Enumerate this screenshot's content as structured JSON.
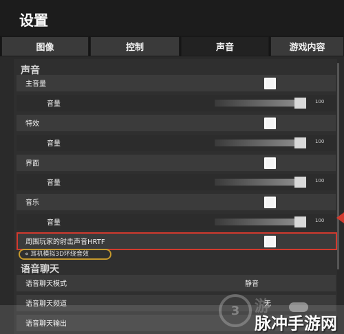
{
  "header": {
    "title": "设置"
  },
  "tabs": [
    {
      "label": "图像"
    },
    {
      "label": "控制"
    },
    {
      "label": "声音"
    },
    {
      "label": "游戏内容"
    }
  ],
  "sound": {
    "section_title": "声音",
    "items": [
      {
        "label": "主音量",
        "checked": false,
        "volume_label": "音量",
        "volume_value": "100",
        "level": 1.0
      },
      {
        "label": "特效",
        "checked": false,
        "volume_label": "音量",
        "volume_value": "100",
        "level": 1.0
      },
      {
        "label": "界面",
        "checked": false,
        "volume_label": "音量",
        "volume_value": "100",
        "level": 1.0
      },
      {
        "label": "音乐",
        "checked": false,
        "volume_label": "音量",
        "volume_value": "100",
        "level": 1.0
      }
    ],
    "hrtf": {
      "label": "周围玩家的射击声音HRTF",
      "checked": false,
      "note": "耳机模拟3D环绕音效"
    }
  },
  "voice_chat": {
    "section_title": "语音聊天",
    "mode_label": "语音聊天模式",
    "mode_value": "静音",
    "channel_label": "语音聊天频道",
    "channel_value": "无",
    "output_label": "语音聊天输出"
  },
  "watermark": {
    "text": "脉冲手游网",
    "brand": "游"
  },
  "colors": {
    "highlight": "#d23a2e",
    "note_outline": "#c79a2c"
  }
}
